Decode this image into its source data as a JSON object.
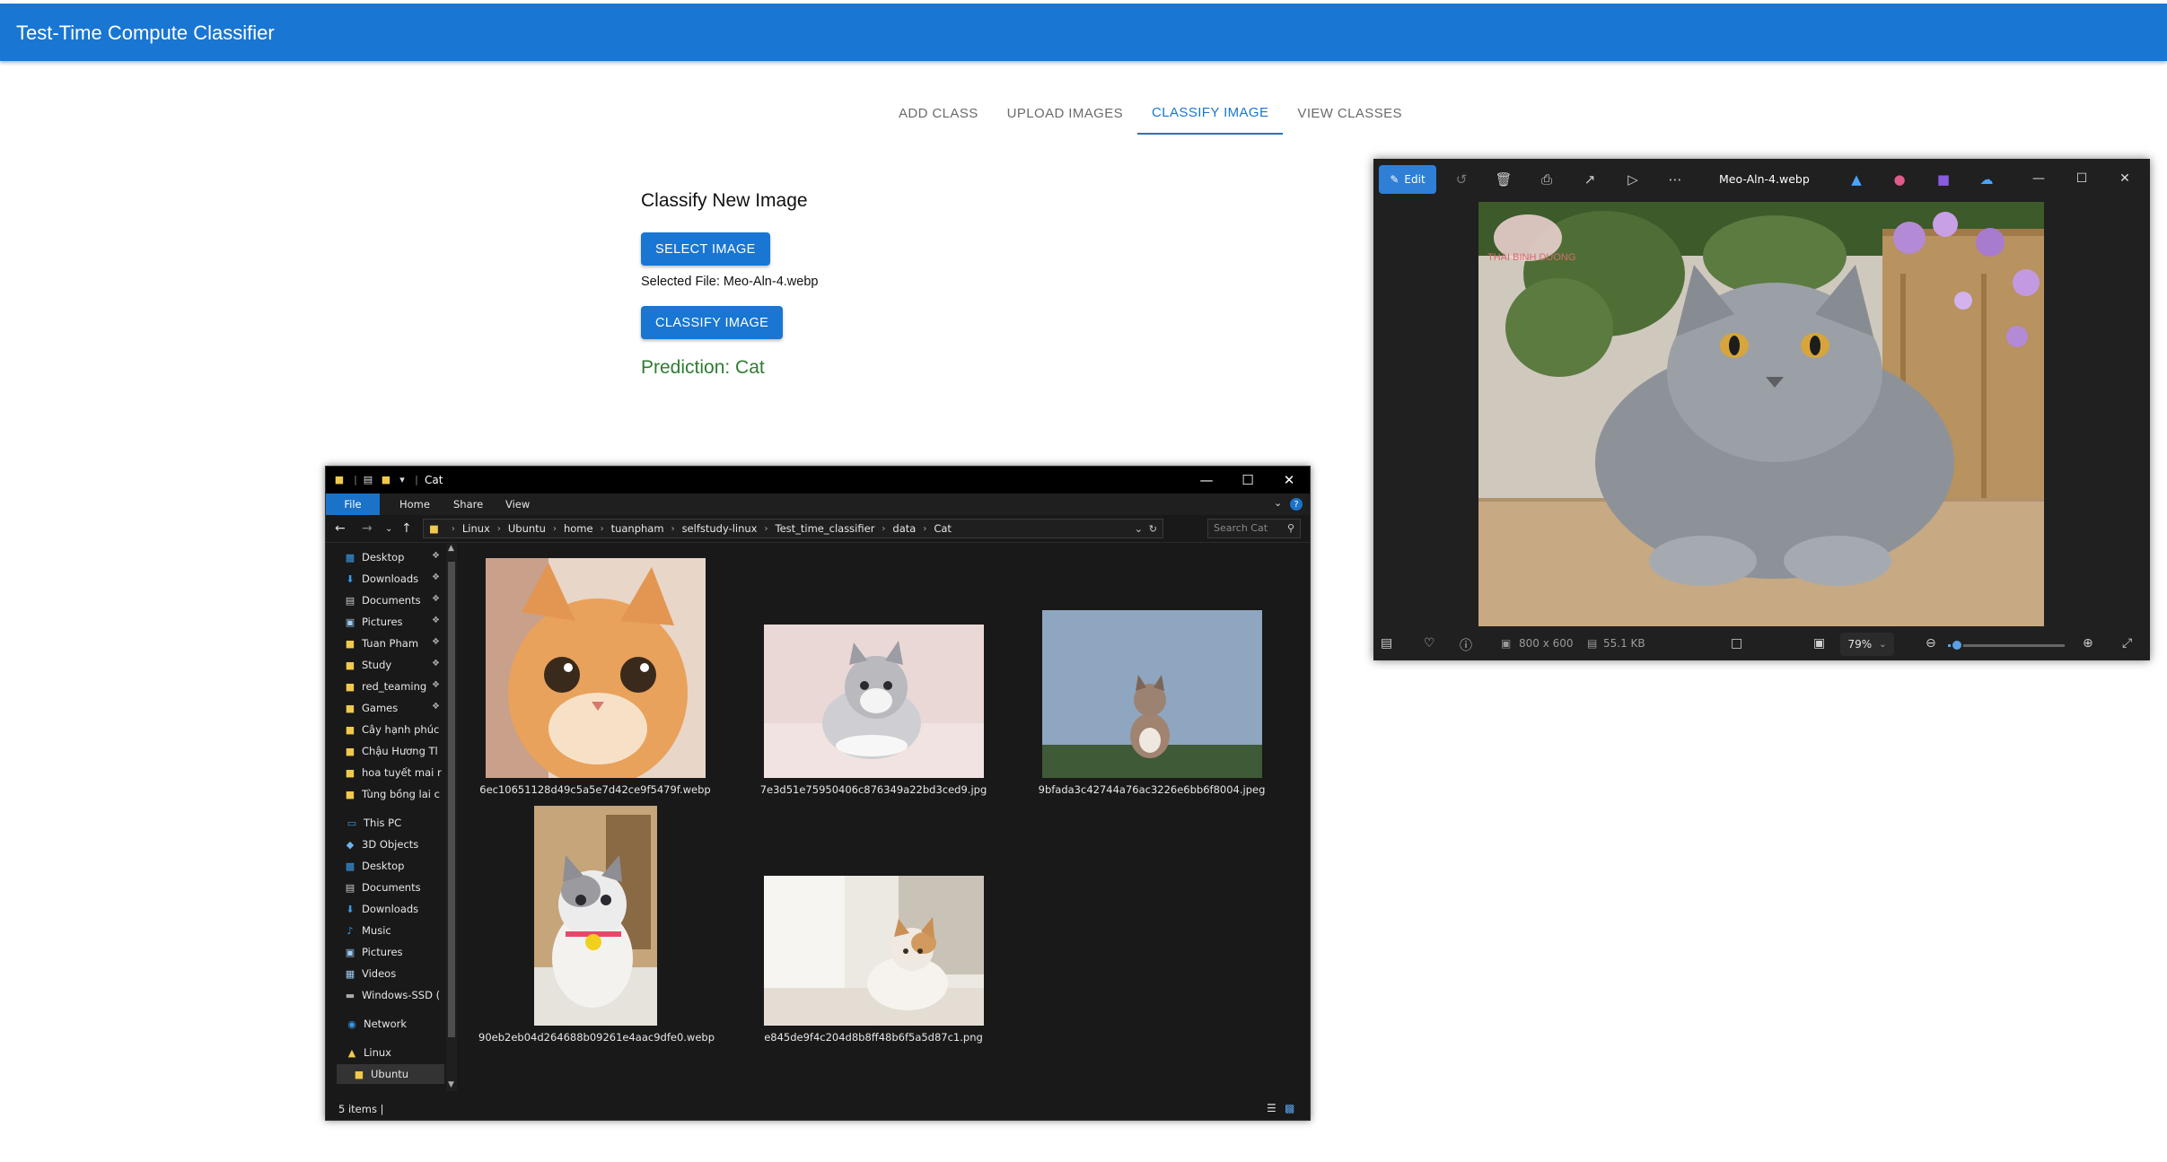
{
  "app": {
    "title": "Test-Time Compute Classifier"
  },
  "tabs": [
    {
      "label": "ADD CLASS"
    },
    {
      "label": "UPLOAD IMAGES"
    },
    {
      "label": "CLASSIFY IMAGE",
      "active": true
    },
    {
      "label": "VIEW CLASSES"
    }
  ],
  "classify": {
    "heading": "Classify New Image",
    "select_label": "SELECT IMAGE",
    "selected_file": "Selected File: Meo-Aln-4.webp",
    "classify_label": "CLASSIFY IMAGE",
    "prediction": "Prediction: Cat"
  },
  "explorer": {
    "title": "Cat",
    "ribbon": [
      "File",
      "Home",
      "Share",
      "View"
    ],
    "breadcrumb": [
      "Linux",
      "Ubuntu",
      "home",
      "tuanpham",
      "selfstudy-linux",
      "Test_time_classifier",
      "data",
      "Cat"
    ],
    "search_placeholder": "Search Cat",
    "nav_quick": [
      {
        "label": "Desktop",
        "icon": "desktop-icon",
        "pinned": true
      },
      {
        "label": "Downloads",
        "icon": "download-icon",
        "pinned": true
      },
      {
        "label": "Documents",
        "icon": "document-icon",
        "pinned": true
      },
      {
        "label": "Pictures",
        "icon": "pictures-icon",
        "pinned": true
      },
      {
        "label": "Tuan Pham",
        "icon": "folder-icon",
        "pinned": true
      },
      {
        "label": "Study",
        "icon": "folder-icon",
        "pinned": true
      },
      {
        "label": "red_teaming",
        "icon": "folder-icon",
        "pinned": true
      },
      {
        "label": "Games",
        "icon": "folder-icon",
        "pinned": true
      },
      {
        "label": "Cây hạnh phúc",
        "icon": "folder-icon",
        "pinned": false
      },
      {
        "label": "Chậu Hương Tl",
        "icon": "folder-icon",
        "pinned": false
      },
      {
        "label": "hoa tuyết mai r",
        "icon": "folder-icon",
        "pinned": false
      },
      {
        "label": "Tùng bồng lai c",
        "icon": "folder-icon",
        "pinned": false
      }
    ],
    "nav_pc": [
      {
        "label": "This PC",
        "icon": "pc-icon"
      },
      {
        "label": "3D Objects",
        "icon": "cube-icon"
      },
      {
        "label": "Desktop",
        "icon": "desktop-icon"
      },
      {
        "label": "Documents",
        "icon": "document-icon"
      },
      {
        "label": "Downloads",
        "icon": "download-icon"
      },
      {
        "label": "Music",
        "icon": "music-icon"
      },
      {
        "label": "Pictures",
        "icon": "pictures-icon"
      },
      {
        "label": "Videos",
        "icon": "video-icon"
      },
      {
        "label": "Windows-SSD (",
        "icon": "drive-icon"
      }
    ],
    "nav_other": [
      {
        "label": "Network",
        "icon": "network-icon"
      },
      {
        "label": "Linux",
        "icon": "linux-icon"
      },
      {
        "label": "Ubuntu",
        "icon": "folder-icon",
        "selected": true
      }
    ],
    "files": [
      {
        "name": "6ec10651128d49c5a5e7d42ce9f5479f.webp"
      },
      {
        "name": "7e3d51e75950406c876349a22bd3ced9.jpg"
      },
      {
        "name": "9bfada3c42744a76ac3226e6bb6f8004.jpeg"
      },
      {
        "name": "90eb2eb04d264688b09261e4aac9dfe0.webp"
      },
      {
        "name": "e845de9f4c204d8b8ff48b6f5a5d87c1.png"
      }
    ],
    "status": "5 items  |"
  },
  "photos": {
    "edit_label": "Edit",
    "title": "Meo-Aln-4.webp",
    "dimensions": "800 x 600",
    "filesize": "55.1 KB",
    "zoom": "79%",
    "zoom_level": 0.08,
    "watermark": "THAI BINH DUONG"
  },
  "colors": {
    "primary": "#1976d2",
    "prediction": "#2e7d32",
    "explorer_bg": "#191919",
    "photos_bg": "#202020"
  }
}
